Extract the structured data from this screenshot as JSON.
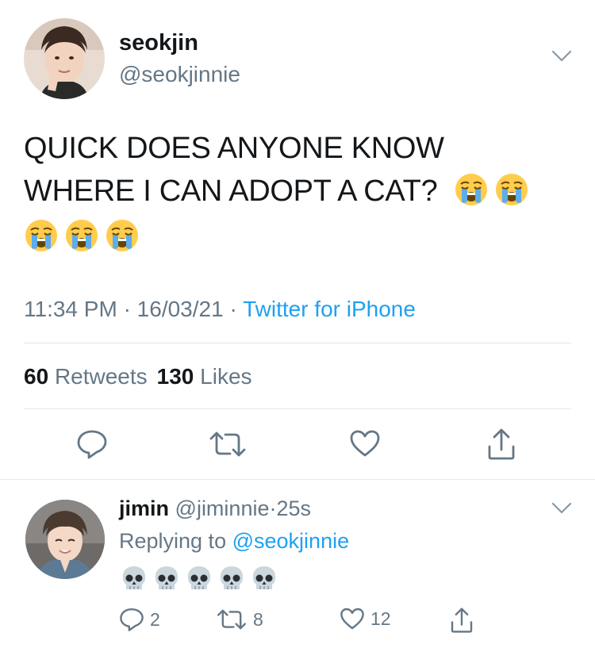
{
  "tweet": {
    "author_name": "seokjin",
    "author_handle": "@seokjinnie",
    "text_line1": "QUICK DOES ANYONE KNOW",
    "text_line2": "WHERE I CAN ADOPT A CAT?",
    "time": "11:34 PM",
    "date": "16/03/21",
    "separator": "·",
    "source": "Twitter for iPhone",
    "retweets_count": "60",
    "retweets_label": "Retweets",
    "likes_count": "130",
    "likes_label": "Likes",
    "emoji": "loudly-crying-face"
  },
  "reply": {
    "author_name": "jimin",
    "author_handle": "@jiminnie",
    "separator": "·",
    "time": "25s",
    "replying_prefix": "Replying to",
    "replying_to": "@seokjinnie",
    "emoji": "skull",
    "reply_count": "2",
    "retweet_count": "8",
    "like_count": "12"
  },
  "colors": {
    "text": "#14171a",
    "secondary": "#657786",
    "accent": "#1da1f2",
    "divider": "#e1e8ed"
  },
  "icons": [
    "chevron-down-icon",
    "reply-icon",
    "retweet-icon",
    "like-icon",
    "share-icon"
  ]
}
